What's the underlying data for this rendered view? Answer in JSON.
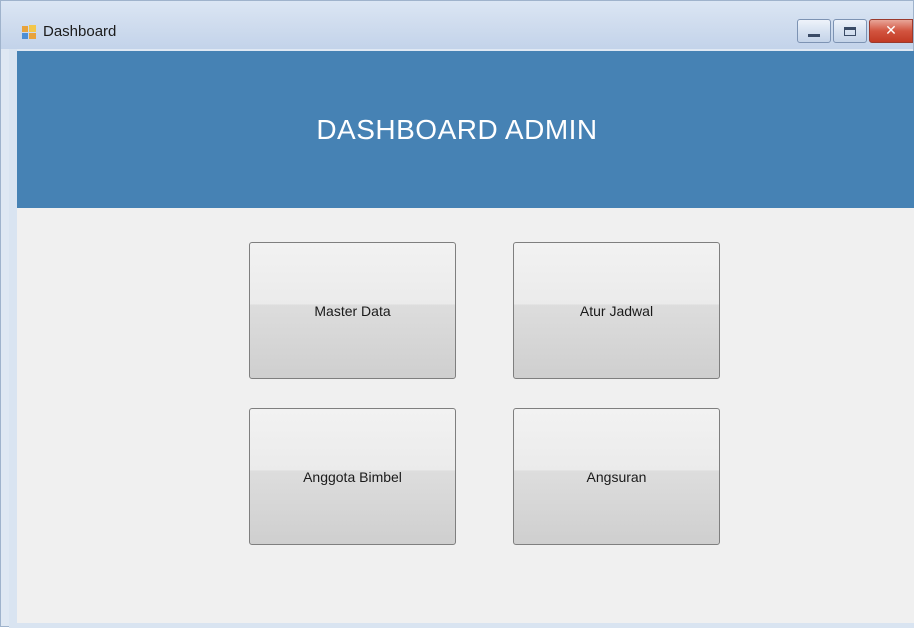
{
  "window": {
    "title": "Dashboard",
    "icon": "winforms-app-icon",
    "controls": {
      "minimize_icon": "minimize-icon",
      "maximize_icon": "maximize-icon",
      "close_label": "✕"
    }
  },
  "header": {
    "title": "DASHBOARD ADMIN",
    "background": "#4682B4",
    "text_color": "#FFFFFF"
  },
  "buttons": [
    {
      "label": "Master Data"
    },
    {
      "label": "Atur Jadwal"
    },
    {
      "label": "Anggota Bimbel"
    },
    {
      "label": "Angsuran"
    }
  ],
  "colors": {
    "client_background": "#F0F0F0",
    "close_button": "#C8432D"
  }
}
